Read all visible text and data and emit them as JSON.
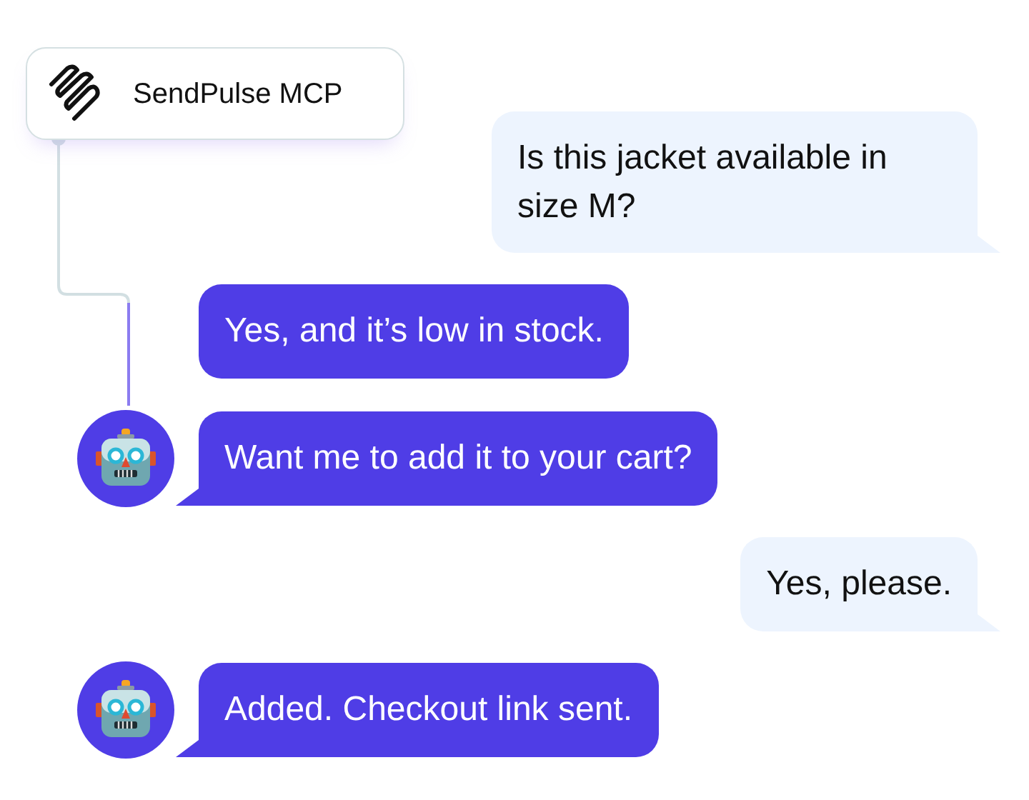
{
  "header": {
    "title": "SendPulse MCP"
  },
  "messages": [
    {
      "kind": "user",
      "text": "Is this jacket available in size M?",
      "avatar": false,
      "tail": true
    },
    {
      "kind": "bot",
      "text": "Yes, and it’s low in stock.",
      "avatar": false,
      "tail": false
    },
    {
      "kind": "bot",
      "text": "Want me to add it to your cart?",
      "avatar": true,
      "tail": true
    },
    {
      "kind": "user",
      "text": "Yes, please.",
      "avatar": false,
      "tail": true
    },
    {
      "kind": "bot",
      "text": "Added. Checkout link sent.",
      "avatar": true,
      "tail": true
    }
  ]
}
